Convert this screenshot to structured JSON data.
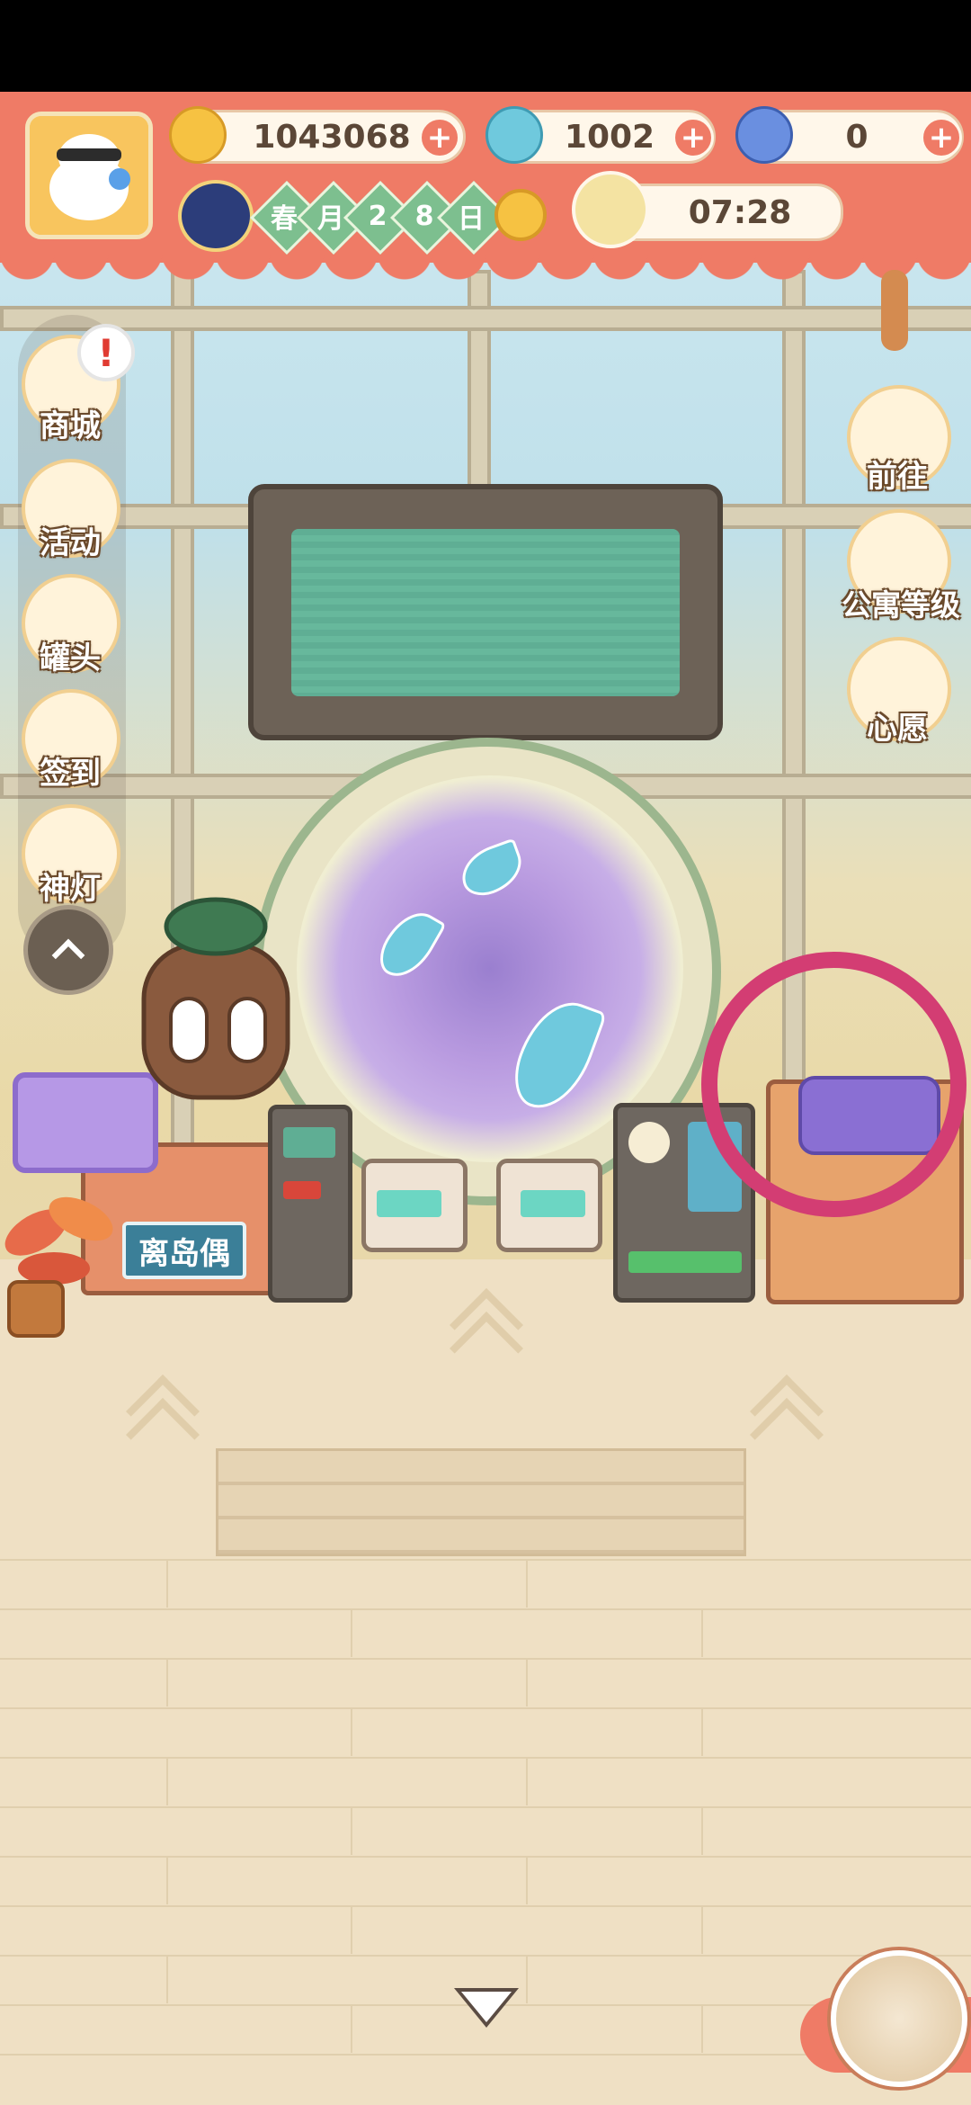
{
  "currencies": {
    "banana": "1043068",
    "fire": "1002",
    "blue_banana": "0"
  },
  "calendar": {
    "season": "春",
    "chars": [
      "月",
      "2",
      "8",
      "日"
    ]
  },
  "clock": "07:28",
  "left_menu": {
    "shop": "商城",
    "events": "活动",
    "cans": "罐头",
    "checkin": "签到",
    "lamp": "神灯"
  },
  "right_menu": {
    "goto": "前往",
    "apartment_level": "公寓等级",
    "wish": "心愿"
  },
  "counter_sign": "离岛偶",
  "badge": "!",
  "colors": {
    "hud": "#ef7b66",
    "highlight": "#d33d73",
    "screen": "#5fae94",
    "portal": "#b99be0"
  }
}
